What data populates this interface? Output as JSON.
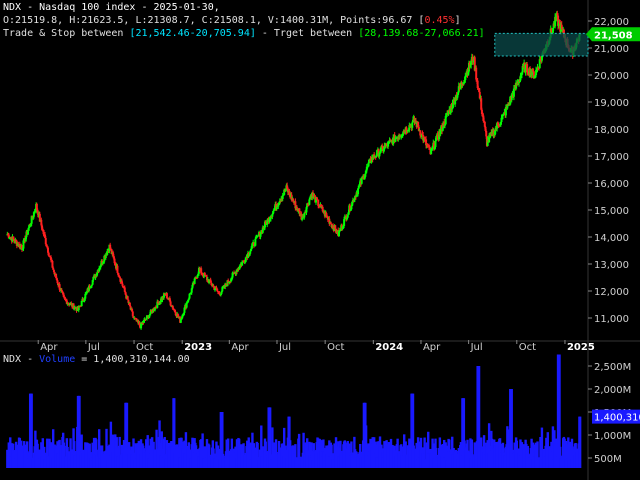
{
  "header": {
    "title": "NDX - Nasdaq 100 index - 2025-01-30,",
    "ohlc": "O:21519.8, H:21623.5, L:21308.7, C:21508.1, V:1400.31M, Points:96.67 ",
    "change": "0.45%",
    "trade_stop_prefix": "Trade & Stop between ",
    "trade_stop": "[21,542.46-20,705.94]",
    "target_prefix": " - Trget between ",
    "target": "[28,139.68-27,066.21]"
  },
  "volume_header": {
    "prefix": "NDX - ",
    "label": "Volume",
    "suffix": " = 1,400,310,144.00"
  },
  "colors": {
    "background": "#000000",
    "up": "#00ff00",
    "down": "#ff2020",
    "volume": "#1a1aff",
    "zone_fill": "#0b4a4a",
    "zone_border": "#20c0c0",
    "price_badge": "#00cc00"
  },
  "chart_data": [
    {
      "type": "candlestick",
      "title": "NDX - Nasdaq 100 index - 2025-01-30",
      "x_tick_labels": [
        "Apr",
        "Jul",
        "Oct",
        "2023",
        "Apr",
        "Jul",
        "Oct",
        "2024",
        "Apr",
        "Jul",
        "Oct",
        "2025"
      ],
      "y_tick_labels": [
        "11,000",
        "12,000",
        "13,000",
        "14,000",
        "15,000",
        "16,000",
        "17,000",
        "18,000",
        "19,000",
        "20,000",
        "21,000",
        "22,000"
      ],
      "ylim": [
        10300,
        22600
      ],
      "last_price_label": "21,508",
      "zone": {
        "low": 20705.94,
        "high": 21542.46
      },
      "keypoints": [
        {
          "date": "2022-02-01",
          "close": 14100
        },
        {
          "date": "2022-03-01",
          "close": 13600
        },
        {
          "date": "2022-03-28",
          "close": 15150
        },
        {
          "date": "2022-05-01",
          "close": 12700
        },
        {
          "date": "2022-05-20",
          "close": 11700
        },
        {
          "date": "2022-06-16",
          "close": 11300
        },
        {
          "date": "2022-08-15",
          "close": 13650
        },
        {
          "date": "2022-09-30",
          "close": 11000
        },
        {
          "date": "2022-10-13",
          "close": 10700
        },
        {
          "date": "2022-11-30",
          "close": 11900
        },
        {
          "date": "2022-12-28",
          "close": 10900
        },
        {
          "date": "2023-02-02",
          "close": 12800
        },
        {
          "date": "2023-03-13",
          "close": 11900
        },
        {
          "date": "2023-05-01",
          "close": 13200
        },
        {
          "date": "2023-07-19",
          "close": 15800
        },
        {
          "date": "2023-08-18",
          "close": 14700
        },
        {
          "date": "2023-09-05",
          "close": 15600
        },
        {
          "date": "2023-10-26",
          "close": 14100
        },
        {
          "date": "2023-12-28",
          "close": 16900
        },
        {
          "date": "2024-03-21",
          "close": 18300
        },
        {
          "date": "2024-04-19",
          "close": 17100
        },
        {
          "date": "2024-07-10",
          "close": 20650
        },
        {
          "date": "2024-08-05",
          "close": 17500
        },
        {
          "date": "2024-09-06",
          "close": 18500
        },
        {
          "date": "2024-10-15",
          "close": 20300
        },
        {
          "date": "2024-11-04",
          "close": 20000
        },
        {
          "date": "2024-12-16",
          "close": 22100
        },
        {
          "date": "2025-01-13",
          "close": 20800
        },
        {
          "date": "2025-01-30",
          "close": 21508
        }
      ]
    },
    {
      "type": "bar",
      "series_label": "Volume",
      "y_tick_labels": [
        "500M",
        "1,000M",
        "1,500M",
        "2,000M",
        "2,500M"
      ],
      "last_value_label": "1,400,310,144",
      "ylim": [
        200,
        2900
      ],
      "typical_range": [
        450,
        1300
      ],
      "spikes": [
        {
          "date": "2022-03-18",
          "value": 1900
        },
        {
          "date": "2022-06-17",
          "value": 1850
        },
        {
          "date": "2022-09-16",
          "value": 1700
        },
        {
          "date": "2022-12-16",
          "value": 1800
        },
        {
          "date": "2023-03-17",
          "value": 1500
        },
        {
          "date": "2023-06-16",
          "value": 1600
        },
        {
          "date": "2023-07-24",
          "value": 1400
        },
        {
          "date": "2023-12-15",
          "value": 1700
        },
        {
          "date": "2024-03-15",
          "value": 1900
        },
        {
          "date": "2024-06-21",
          "value": 1800
        },
        {
          "date": "2024-07-19",
          "value": 2500
        },
        {
          "date": "2024-09-20",
          "value": 2000
        },
        {
          "date": "2024-12-20",
          "value": 2750
        },
        {
          "date": "2025-01-30",
          "value": 1400
        }
      ]
    }
  ]
}
